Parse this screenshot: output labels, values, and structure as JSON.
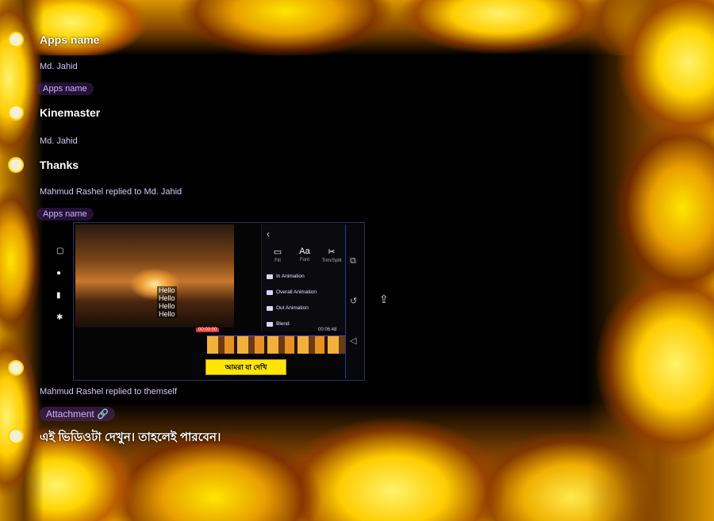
{
  "messages": [
    {
      "title": "Apps name"
    },
    {
      "reply_meta": "Md. Jahid",
      "reply_quote": "Apps name",
      "title": "Kinemaster"
    },
    {
      "reply_meta": "Md. Jahid",
      "title": "Thanks"
    },
    {
      "reply_meta": "Mahmud Rashel replied to Md. Jahid",
      "reply_quote": "Apps name"
    }
  ],
  "embed": {
    "hello_lines": [
      "Hello",
      "Hello",
      "Hello",
      "Hello"
    ],
    "tools": [
      {
        "icon": "text-box-icon",
        "glyph": "▭",
        "label": "Fill"
      },
      {
        "icon": "font-icon",
        "glyph": "Aa",
        "label": "Font"
      },
      {
        "icon": "scissors-icon",
        "glyph": "✂",
        "label": "Trim/Split"
      }
    ],
    "menu_items": [
      "In Animation",
      "Overall Animation",
      "Out Animation",
      "Blend"
    ],
    "timeline_tag": "00:00:00",
    "timeline_end": "00:06:48",
    "caption_text": "আমরা যা দেখি",
    "rail_icons": [
      {
        "name": "layers-icon",
        "glyph": "⧉"
      },
      {
        "name": "undo-icon",
        "glyph": "↺"
      },
      {
        "name": "back-arrow-icon",
        "glyph": "◁"
      }
    ],
    "left_icons": [
      {
        "name": "media-icon",
        "glyph": "▢"
      },
      {
        "name": "record-icon",
        "glyph": "●"
      },
      {
        "name": "delete-icon",
        "glyph": "▮"
      },
      {
        "name": "settings-icon",
        "glyph": "✱"
      }
    ]
  },
  "after_embed": {
    "reply_meta": "Mahmud Rashel replied to themself",
    "attachment": "Attachment 🔗",
    "bangla_text": "এই ভিডিওটা দেখুন। তাহলেই পারবেন।"
  },
  "share_icon": "share-icon"
}
